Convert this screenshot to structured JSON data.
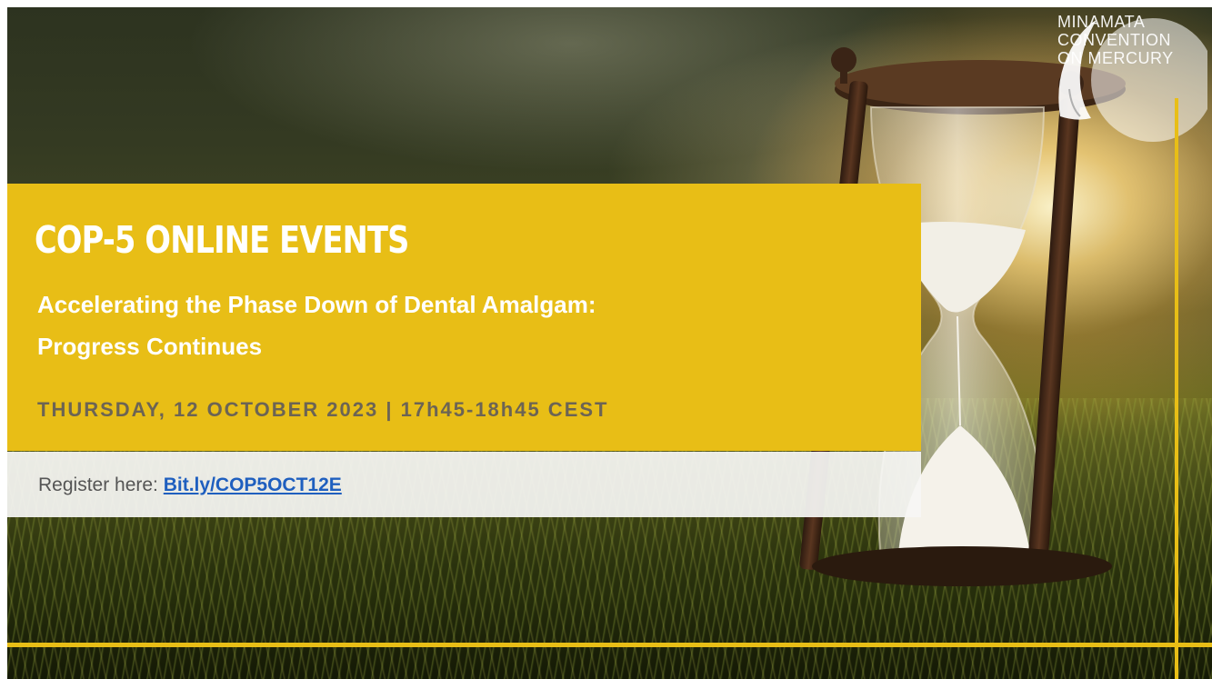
{
  "event": {
    "series_title": "COP-5 ONLINE EVENTS",
    "subtitle_line1": "Accelerating the Phase Down of Dental Amalgam:",
    "subtitle_line2": "Progress Continues",
    "date_time": "THURSDAY, 12 OCTOBER 2023 | 17h45-18h45 CEST"
  },
  "registration": {
    "label": "Register here: ",
    "link_text": "Bit.ly/COP5OCT12E"
  },
  "logo": {
    "line1": "MINAMATA",
    "line2": "CONVENTION",
    "line3": "ON MERCURY"
  },
  "colors": {
    "accent": "#e8be16",
    "link": "#1f5fbf",
    "date_text": "#6c6454"
  },
  "icons": {
    "logo_mark": "minamata-bird-droplet-logo",
    "background": "hourglass-in-grass-photo"
  }
}
